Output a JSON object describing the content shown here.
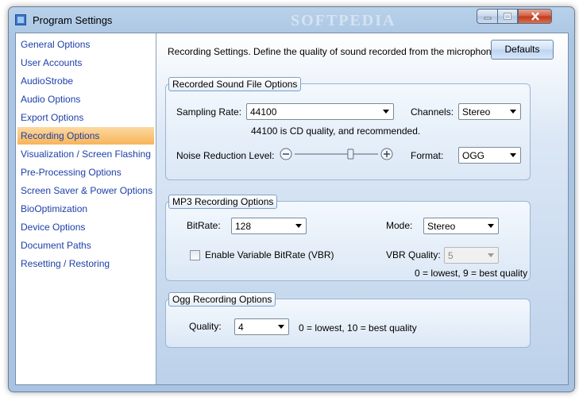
{
  "window": {
    "title": "Program Settings",
    "watermark": "SOFTPEDIA",
    "watermark_url": "www.softpedia.com"
  },
  "sidebar": {
    "items": [
      {
        "label": "General Options"
      },
      {
        "label": "User Accounts"
      },
      {
        "label": "AudioStrobe"
      },
      {
        "label": "Audio Options"
      },
      {
        "label": "Export Options"
      },
      {
        "label": "Recording Options"
      },
      {
        "label": "Visualization / Screen Flashing"
      },
      {
        "label": "Pre-Processing Options"
      },
      {
        "label": "Screen Saver & Power Options"
      },
      {
        "label": "BioOptimization"
      },
      {
        "label": "Device Options"
      },
      {
        "label": "Document Paths"
      },
      {
        "label": "Resetting / Restoring"
      }
    ],
    "active": "Recording Options"
  },
  "main": {
    "description": "Recording Settings. Define the quality of sound recorded from the microphone.",
    "defaults_label": "Defaults",
    "recorded": {
      "title": "Recorded Sound File Options",
      "sampling_label": "Sampling Rate:",
      "sampling_value": "44100",
      "sampling_note": "44100 is CD quality, and recommended.",
      "channels_label": "Channels:",
      "channels_value": "Stereo",
      "noise_label": "Noise Reduction Level:",
      "noise_level": 0.67,
      "format_label": "Format:",
      "format_value": "OGG"
    },
    "mp3": {
      "title": "MP3 Recording Options",
      "bitrate_label": "BitRate:",
      "bitrate_value": "128",
      "mode_label": "Mode:",
      "mode_value": "Stereo",
      "vbr_label": "Enable Variable BitRate (VBR)",
      "vbr_checked": false,
      "vbr_quality_label": "VBR Quality:",
      "vbr_quality_value": "5",
      "vbr_note": "0 = lowest, 9 = best quality"
    },
    "ogg": {
      "title": "Ogg Recording Options",
      "quality_label": "Quality:",
      "quality_value": "4",
      "quality_note": "0 = lowest, 10 = best quality"
    }
  }
}
